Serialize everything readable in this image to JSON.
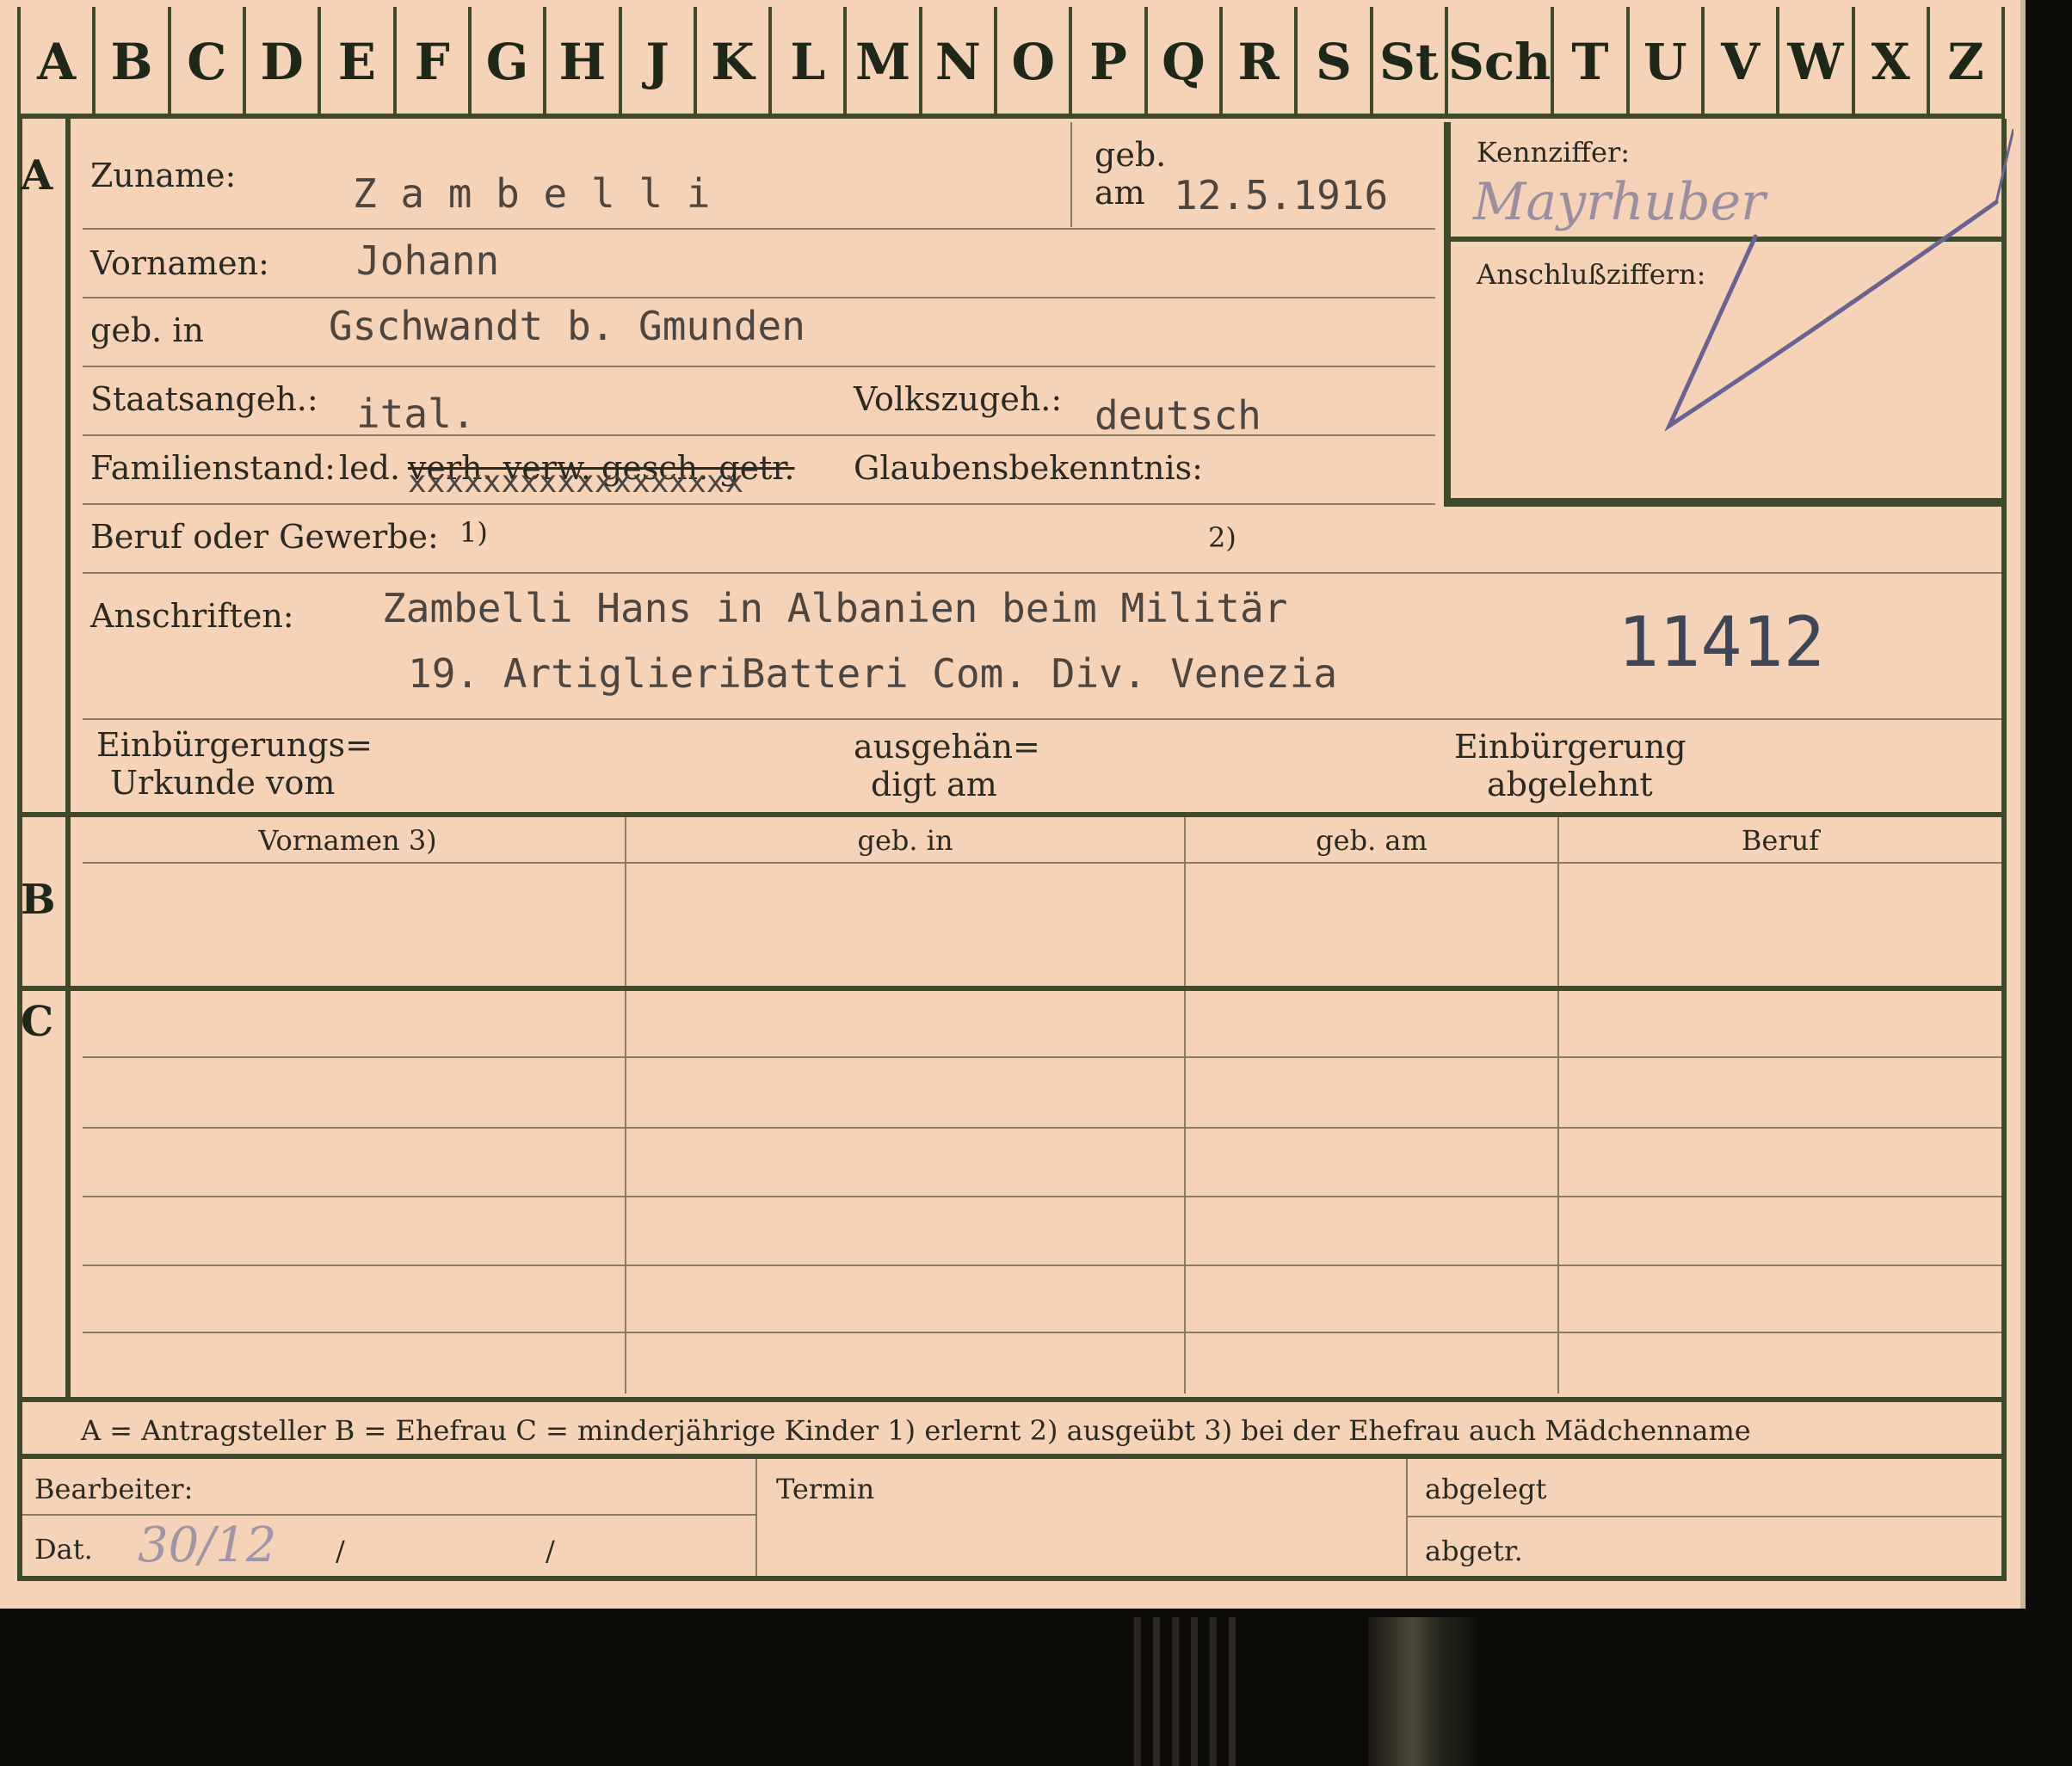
{
  "alphabet": [
    "A",
    "B",
    "C",
    "D",
    "E",
    "F",
    "G",
    "H",
    "J",
    "K",
    "L",
    "M",
    "N",
    "O",
    "P",
    "Q",
    "R",
    "S",
    "St",
    "Sch",
    "T",
    "U",
    "V",
    "W",
    "X",
    "Z"
  ],
  "section_a": {
    "marker": "A",
    "surname_label": "Zuname:",
    "surname_value": "Z a m b e l l i",
    "born_label_1": "geb.",
    "born_label_2": "am",
    "born_value": "12.5.1916",
    "code_label": "Kennziffer:",
    "code_handwritten": "Mayrhuber",
    "connection_label": "Anschlußziffern:",
    "firstnames_label": "Vornamen:",
    "firstnames_value": "Johann",
    "birthplace_label": "geb. in",
    "birthplace_value": "Gschwandt b. Gmunden",
    "citizenship_label": "Staatsangeh.:",
    "citizenship_value": "ital.",
    "ethnicity_label": "Volkszugeh.:",
    "ethnicity_value": "deutsch",
    "marital_label": "Familienstand:",
    "marital_single": "led.",
    "marital_struck": "verh. verw. gesch. getr.",
    "marital_overtype": "xxxxxxxxxxxxxxxxxx",
    "religion_label": "Glaubensbekenntnis:",
    "profession_label": "Beruf oder Gewerbe:",
    "profession_note1": "1)",
    "profession_note2": "2)",
    "address_label": "Anschriften:",
    "address_line1": "Zambelli  Hans   in Albanien   beim Militär",
    "address_line2": "19. ArtiglieriBatteri Com. Div. Venezia",
    "stamp_number": "11412",
    "naturalization_doc_1": "Einbürgerungs=",
    "naturalization_doc_2": "Urkunde vom",
    "handed_1": "ausgehän=",
    "handed_2": "digt am",
    "refused_1": "Einbürgerung",
    "refused_2": "abgelehnt"
  },
  "section_b": {
    "marker": "B",
    "col_firstnames": "Vornamen 3)",
    "col_birthplace": "geb. in",
    "col_birthdate": "geb. am",
    "col_profession": "Beruf"
  },
  "section_c": {
    "marker": "C"
  },
  "legend": "A = Antragsteller   B = Ehefrau   C = minderjährige Kinder   1) erlernt   2) ausgeübt   3) bei der Ehefrau auch Mädchenname",
  "footer": {
    "clerk_label": "Bearbeiter:",
    "date_label": "Dat.",
    "date_handwritten": "30/12",
    "date_sep1": "/",
    "date_sep2": "/",
    "deadline_label": "Termin",
    "filed_label": "abgelegt",
    "transferred_label": "abgetr."
  }
}
